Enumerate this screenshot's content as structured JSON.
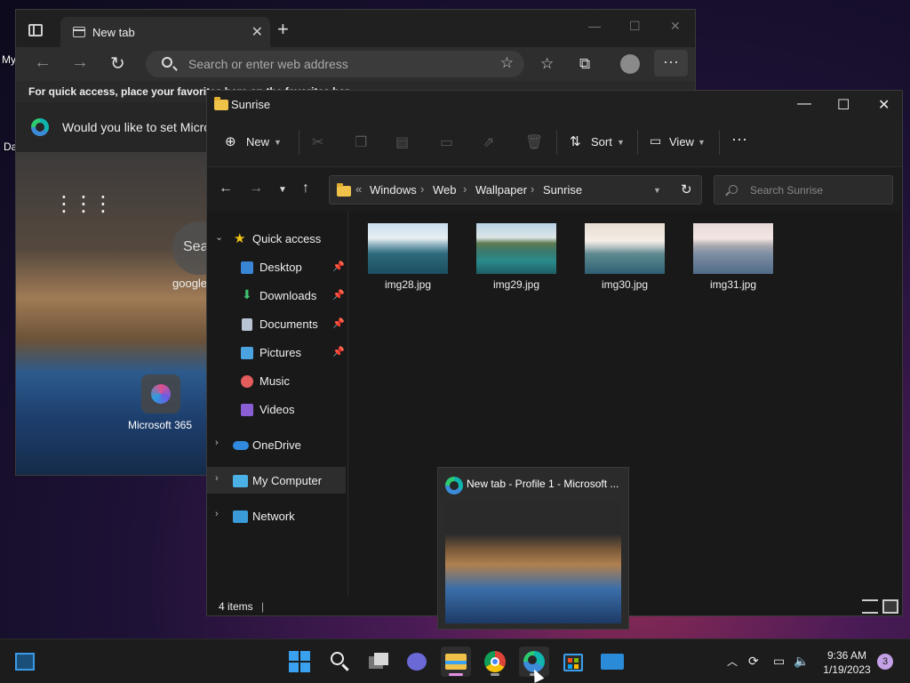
{
  "desktop": {
    "label_my": "My",
    "label_da": "Da"
  },
  "edge": {
    "tab_title": "New tab",
    "address_placeholder": "Search or enter web address",
    "favbar_text": "For quick access, place your favorites here on the favorites bar.",
    "infobar_text": "Would you like to set Micros",
    "search_label": "Sea",
    "google_label": "google",
    "m365_label": "Microsoft 365"
  },
  "explorer": {
    "title": "Sunrise",
    "commands": {
      "new": "New",
      "sort": "Sort",
      "view": "View"
    },
    "breadcrumb": [
      "Windows",
      "Web",
      "Wallpaper",
      "Sunrise"
    ],
    "search_placeholder": "Search Sunrise",
    "sidebar": [
      {
        "label": "Quick access",
        "icon": "star-icon"
      },
      {
        "label": "Desktop",
        "icon": "desktop-icon",
        "pinned": true
      },
      {
        "label": "Downloads",
        "icon": "download-icon",
        "pinned": true
      },
      {
        "label": "Documents",
        "icon": "document-icon",
        "pinned": true
      },
      {
        "label": "Pictures",
        "icon": "pictures-icon",
        "pinned": true
      },
      {
        "label": "Music",
        "icon": "music-icon"
      },
      {
        "label": "Videos",
        "icon": "videos-icon"
      },
      {
        "label": "OneDrive",
        "icon": "onedrive-icon"
      },
      {
        "label": "My Computer",
        "icon": "computer-icon"
      },
      {
        "label": "Network",
        "icon": "network-icon"
      }
    ],
    "files": [
      "img28.jpg",
      "img29.jpg",
      "img30.jpg",
      "img31.jpg"
    ],
    "status_count": "4 items"
  },
  "preview": {
    "title": "New tab - Profile 1 - Microsoft ..."
  },
  "taskbar": {
    "time": "9:36 AM",
    "date": "1/19/2023",
    "notification_count": "3"
  },
  "colors": {
    "accent": "#3b8bd8",
    "folder": "#f0c24a",
    "taskbar_indicator": "#e38fe6"
  }
}
